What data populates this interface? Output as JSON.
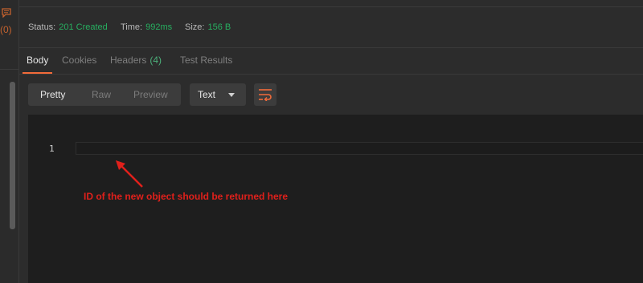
{
  "sidebar": {
    "comments_count": "(0)"
  },
  "status_bar": {
    "status_label": "Status:",
    "status_value": "201 Created",
    "time_label": "Time:",
    "time_value": "992ms",
    "size_label": "Size:",
    "size_value": "156 B",
    "value_color": "#27ae60"
  },
  "tabs": {
    "body": "Body",
    "cookies": "Cookies",
    "headers": "Headers",
    "headers_count": "(4)",
    "test_results": "Test Results",
    "active": "Body",
    "accent": "#f26b3a"
  },
  "toolbar": {
    "pretty": "Pretty",
    "raw": "Raw",
    "preview": "Preview",
    "format_selected": "Text",
    "wrap_icon": "wrap-lines-icon"
  },
  "editor": {
    "line_number": "1",
    "content": ""
  },
  "annotation": {
    "text": "ID of the new object should be returned here",
    "color": "#e0201b"
  }
}
